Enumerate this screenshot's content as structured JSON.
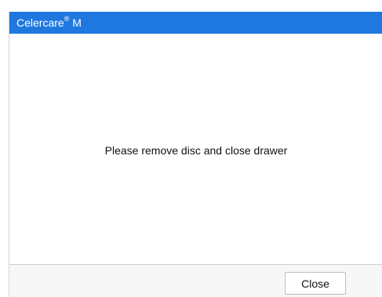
{
  "dialog": {
    "title_main": "Celercare",
    "title_reg": "®",
    "title_suffix": " M",
    "message": "Please remove disc and close drawer",
    "close_label": "Close"
  },
  "colors": {
    "title_bar": "#1f78e0",
    "title_text": "#ffffff",
    "footer_bg": "#f7f7f7"
  }
}
